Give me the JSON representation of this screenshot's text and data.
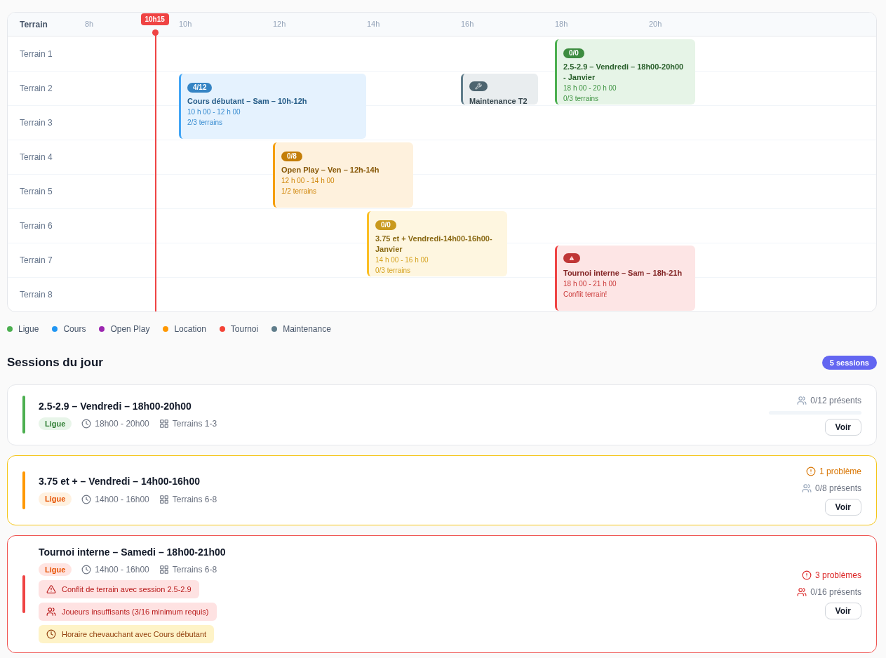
{
  "timeline": {
    "header_label": "Terrain",
    "hours": [
      "8h",
      "10h",
      "12h",
      "14h",
      "16h",
      "18h",
      "20h"
    ],
    "now": {
      "label": "10h15"
    },
    "lanes": [
      "Terrain 1",
      "Terrain 2",
      "Terrain 3",
      "Terrain 4",
      "Terrain 5",
      "Terrain 6",
      "Terrain 7",
      "Terrain 8"
    ],
    "events": [
      {
        "title": "Cours débutant – Sam – 10h-12h",
        "time": "10 h 00 - 12 h 00",
        "terrains": "2/3 terrains",
        "color": "#42a5f5",
        "badge": {
          "kind": "count",
          "text": "4/12"
        }
      },
      {
        "title": "Maintenance T2",
        "color": "#607d8b",
        "badge": {
          "kind": "wrench"
        }
      },
      {
        "title": "2.5-2.9 – Vendredi – 18h00-20h00 - Janvier",
        "time": "18 h 00 - 20 h 00",
        "terrains": "0/3 terrains",
        "color": "#4caf50",
        "badge": {
          "kind": "count",
          "text": "0/0"
        }
      },
      {
        "title": "Open Play – Ven – 12h-14h",
        "time": "12 h 00 - 14 h 00",
        "terrains": "1/2 terrains",
        "color": "#f59e0b",
        "badge": {
          "kind": "count",
          "text": "0/8"
        }
      },
      {
        "title": "3.75 et + Vendredi-14h00-16h00-Janvier",
        "time": "14 h 00 - 16 h 00",
        "terrains": "0/3 terrains",
        "color": "#fbbf24",
        "badge": {
          "kind": "count",
          "text": "0/0"
        }
      },
      {
        "title": "Tournoi interne – Sam – 18h-21h",
        "time": "18 h 00 - 21 h 00",
        "terrains": "Conflit terrain!",
        "color": "#ef4444",
        "badge": {
          "kind": "warning"
        }
      }
    ]
  },
  "legend": [
    {
      "label": "Ligue",
      "color": "#4caf50"
    },
    {
      "label": "Cours",
      "color": "#2196f3"
    },
    {
      "label": "Open Play",
      "color": "#9c27b0"
    },
    {
      "label": "Location",
      "color": "#ff9800"
    },
    {
      "label": "Tournoi",
      "color": "#f44336"
    },
    {
      "label": "Maintenance",
      "color": "#607d8b"
    }
  ],
  "sessions_title": "Sessions du jour",
  "sessions_count": "5 sessions",
  "sessions": [
    {
      "title": "2.5-2.9 – Vendredi – 18h00-20h00",
      "tag": "Ligue",
      "time": "18h00 - 20h00",
      "terrains": "Terrains 1-3",
      "kind": "ok",
      "color": "#4caf50",
      "presence": "0/12 présents",
      "progress": {
        "level": 0
      },
      "button": "Voir"
    },
    {
      "title": "3.75 et + – Vendredi – 14h00-16h00",
      "tag": "Ligue",
      "time": "14h00 - 16h00",
      "terrains": "Terrains 6-8",
      "kind": "warning",
      "color": "#ff9800",
      "problems": "1 problème",
      "presence": "0/8 présents",
      "button": "Voir"
    },
    {
      "title": "Tournoi interne – Samedi – 18h00-21h00",
      "tag": "Ligue",
      "time": "14h00 - 16h00",
      "terrains": "Terrains 6-8",
      "kind": "error",
      "color": "#ef4444",
      "problems": "3 problèmes",
      "presence": "0/16 présents",
      "button": "Voir",
      "issues": [
        {
          "kind": "conflict",
          "text": "Conflit de terrain avec session 2.5-2.9"
        },
        {
          "kind": "players",
          "text": "Joueurs insuffisants (3/16 minimum requis)"
        },
        {
          "kind": "overlap",
          "text": "Horaire chevauchant avec Cours débutant"
        }
      ]
    }
  ]
}
